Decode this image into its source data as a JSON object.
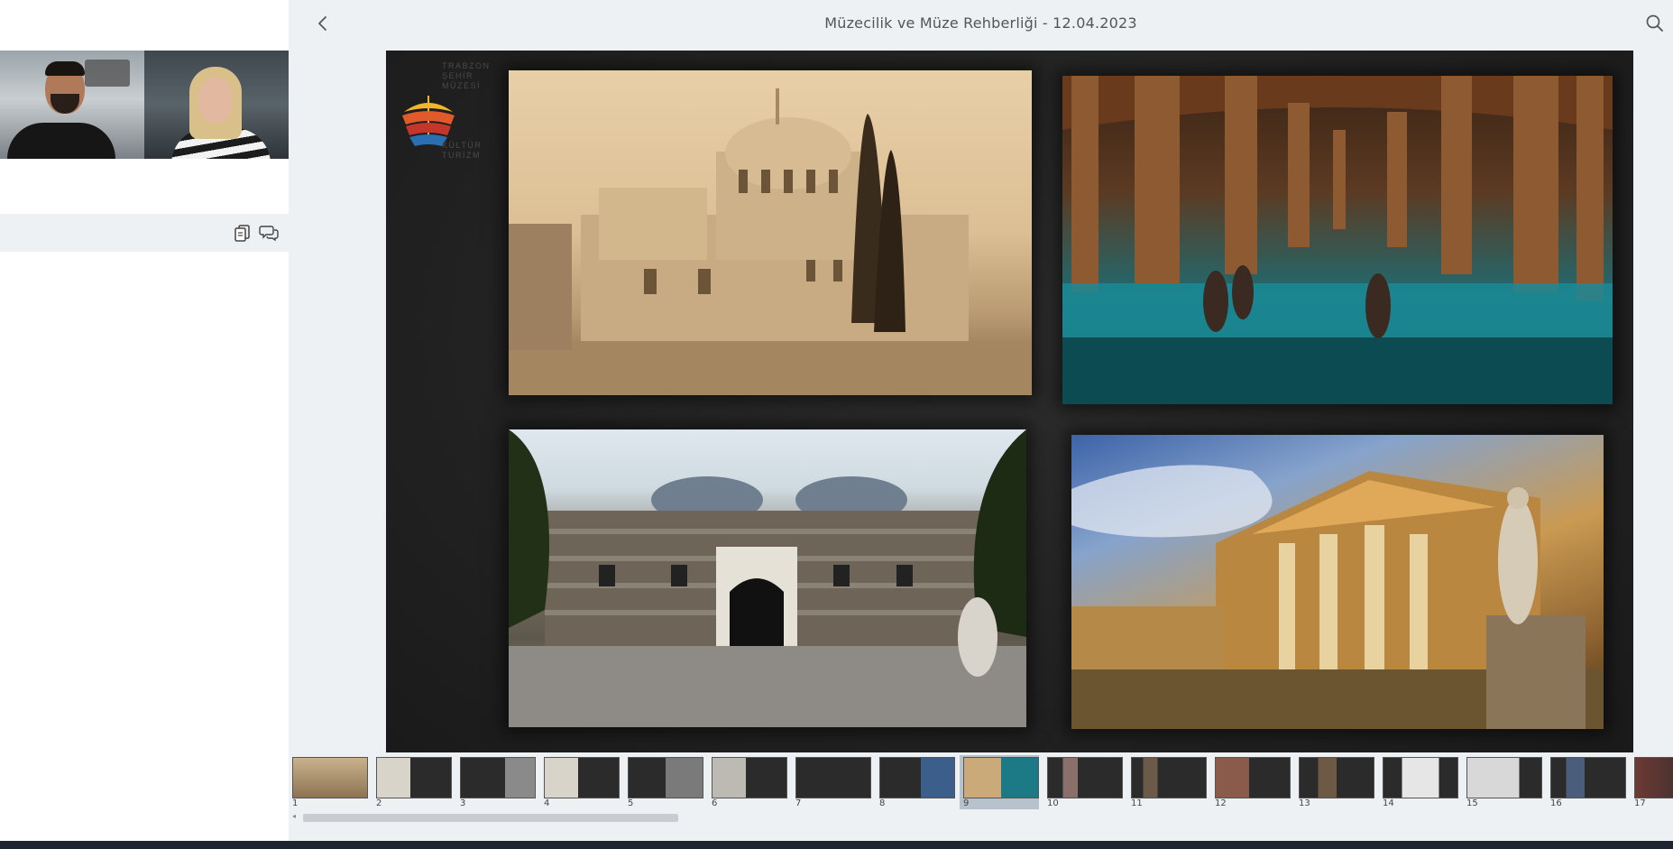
{
  "main": {
    "title": "Müzecilik ve Müze Rehberliği - 12.04.2023"
  },
  "slide": {
    "logo_text_top": "TRABZON\nŞEHİR\nMÜZESİ",
    "logo_text_bottom": "KÜLTÜR\nTURİZM"
  },
  "thumbnails": [
    {
      "num": "1"
    },
    {
      "num": "2"
    },
    {
      "num": "3"
    },
    {
      "num": "4"
    },
    {
      "num": "5"
    },
    {
      "num": "6"
    },
    {
      "num": "7"
    },
    {
      "num": "8"
    },
    {
      "num": "9"
    },
    {
      "num": "10"
    },
    {
      "num": "11"
    },
    {
      "num": "12"
    },
    {
      "num": "13"
    },
    {
      "num": "14"
    },
    {
      "num": "15"
    },
    {
      "num": "16"
    },
    {
      "num": "17"
    }
  ],
  "active_thumbnail": 9,
  "icons": {
    "back": "chevron-left-icon",
    "search": "search-icon",
    "notes": "document-copy-icon",
    "chat": "chat-bubbles-icon"
  },
  "colors": {
    "background": "#eef1f4",
    "slide": "#262626",
    "bottom_bar": "#1c2530"
  }
}
